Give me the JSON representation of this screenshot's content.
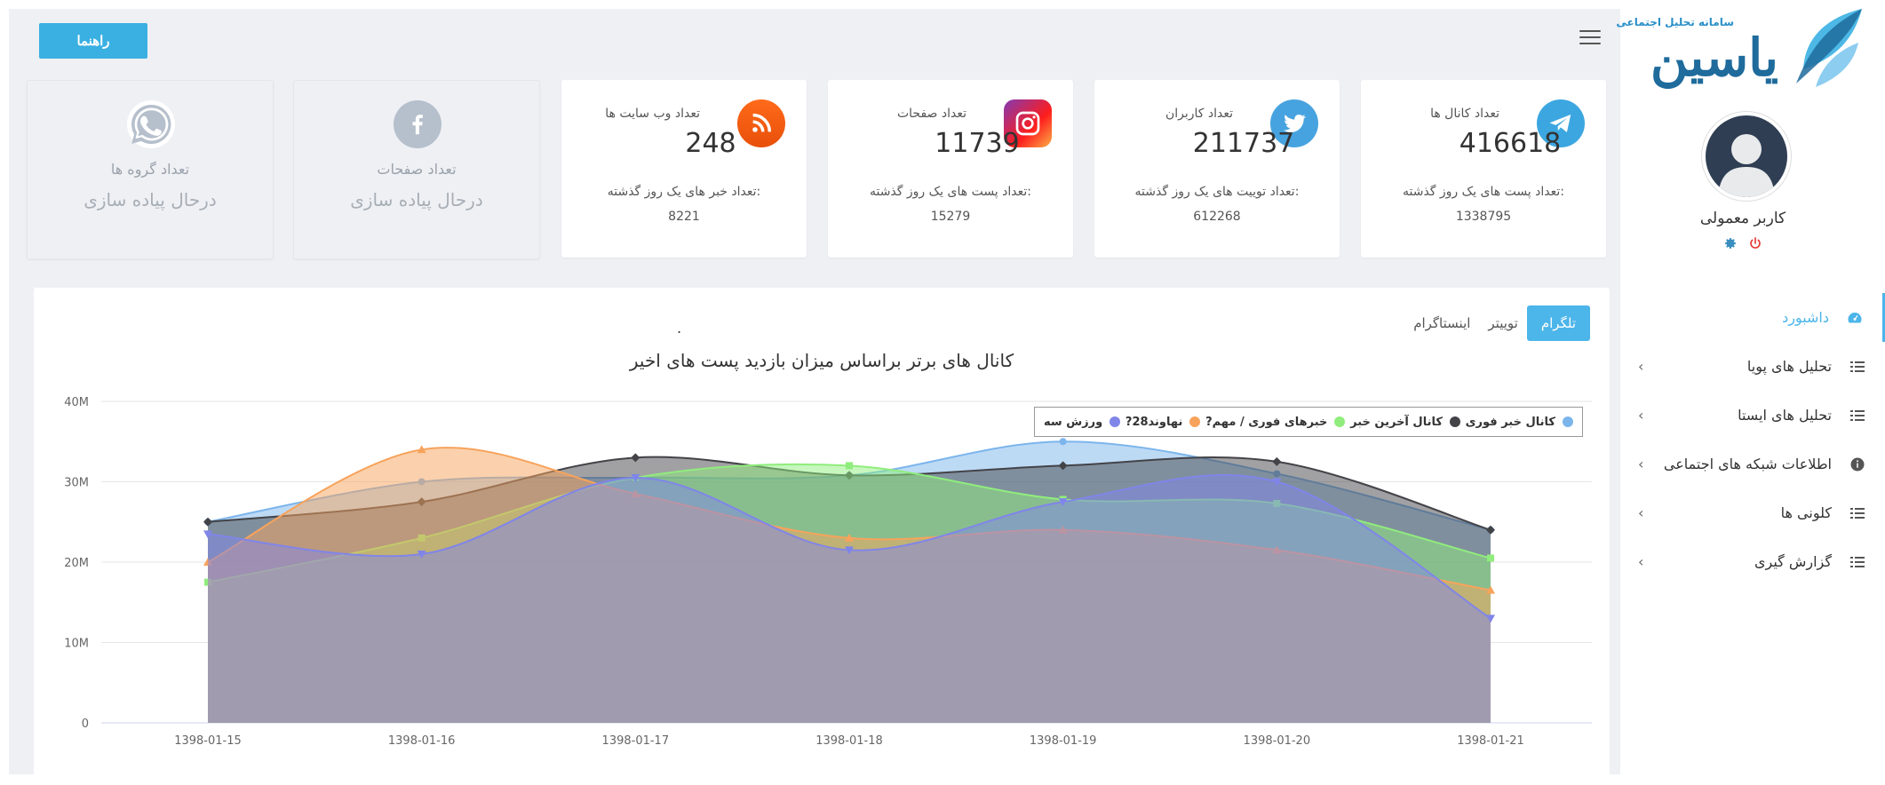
{
  "colors": {
    "accent": "#3ab0e2",
    "telegram": "#3ca6e0",
    "twitter": "#47a3df",
    "rss": "#f7931e",
    "instagram": "#c13584"
  },
  "topbar": {
    "help_button": "راهنما",
    "menu_icon": "hamburger-icon"
  },
  "cards": [
    {
      "id": "channels",
      "icon": "telegram-icon",
      "title": "تعداد کانال ها",
      "value": "416618",
      "sub_label": "تعداد پست های یک روز گذشته:",
      "sub_value": "1338795"
    },
    {
      "id": "users",
      "icon": "twitter-icon",
      "title": "تعداد کاربران",
      "value": "211737",
      "sub_label": "تعداد توییت های یک روز گذشته:",
      "sub_value": "612268"
    },
    {
      "id": "pages",
      "icon": "instagram-icon",
      "title": "تعداد صفحات",
      "value": "11739",
      "sub_label": "تعداد پست های یک روز گذشته:",
      "sub_value": "15279"
    },
    {
      "id": "websites",
      "icon": "rss-icon",
      "title": "تعداد وب سایت ها",
      "value": "248",
      "sub_label": "تعداد خبر های یک روز گذشته:",
      "sub_value": "8221"
    }
  ],
  "disabled_cards": [
    {
      "id": "fb",
      "icon": "facebook-icon",
      "title": "تعداد صفحات",
      "status": "درحال پیاده سازی"
    },
    {
      "id": "wa",
      "icon": "whatsapp-icon",
      "title": "تعداد گروه ها",
      "status": "درحال پیاده سازی"
    }
  ],
  "chart_panel": {
    "tabs": [
      "تلگرام",
      "توییتر",
      "اینستاگرام"
    ],
    "active_tab": "تلگرام",
    "dot": "."
  },
  "chart_data": {
    "type": "area",
    "title": "کانال های برتر براساس میزان بازدید پست های اخیر",
    "x": [
      "1398-01-15",
      "1398-01-16",
      "1398-01-17",
      "1398-01-18",
      "1398-01-19",
      "1398-01-20",
      "1398-01-21"
    ],
    "y_ticks": [
      "0",
      "10M",
      "20M",
      "30M",
      "40M"
    ],
    "ylim": [
      0,
      40000000
    ],
    "grid": true,
    "legend_position": "top-right",
    "series": [
      {
        "name": "کانال خبر فوری",
        "color": "#7cb5ec",
        "values": [
          25000000,
          30000000,
          30500000,
          30800000,
          35000000,
          31000000,
          24000000
        ]
      },
      {
        "name": "کانال آخرین خبر",
        "color": "#434348",
        "values": [
          25000000,
          27500000,
          33000000,
          30800000,
          32000000,
          32500000,
          24000000
        ]
      },
      {
        "name": "?خبرهای فوری / مهم",
        "color": "#90ed7d",
        "values": [
          17500000,
          23000000,
          30500000,
          32000000,
          27800000,
          27300000,
          20500000
        ]
      },
      {
        "name": "?نهاوند28",
        "color": "#f7a35c",
        "values": [
          20000000,
          34000000,
          28500000,
          23000000,
          24000000,
          21500000,
          16500000
        ]
      },
      {
        "name": "ورزش سه",
        "color": "#8085e9",
        "values": [
          23500000,
          21000000,
          30500000,
          21500000,
          27500000,
          30000000,
          13000000
        ]
      }
    ]
  },
  "sidebar": {
    "logo_sub": "سامانه تحلیل اجتماعی",
    "logo_main": "یاسین",
    "username": "کاربر معمولی",
    "menu": [
      {
        "label": "داشبورد",
        "icon": "dashboard-icon",
        "active": true,
        "chevron": false
      },
      {
        "label": "تحلیل های پویا",
        "icon": "list-icon",
        "active": false,
        "chevron": true
      },
      {
        "label": "تحلیل های ایستا",
        "icon": "list-icon",
        "active": false,
        "chevron": true
      },
      {
        "label": "اطلاعات شبکه های اجتماعی",
        "icon": "info-icon",
        "active": false,
        "chevron": true
      },
      {
        "label": "کلونی ها",
        "icon": "list-icon",
        "active": false,
        "chevron": true
      },
      {
        "label": "گزارش گیری",
        "icon": "list-icon",
        "active": false,
        "chevron": true
      }
    ]
  }
}
